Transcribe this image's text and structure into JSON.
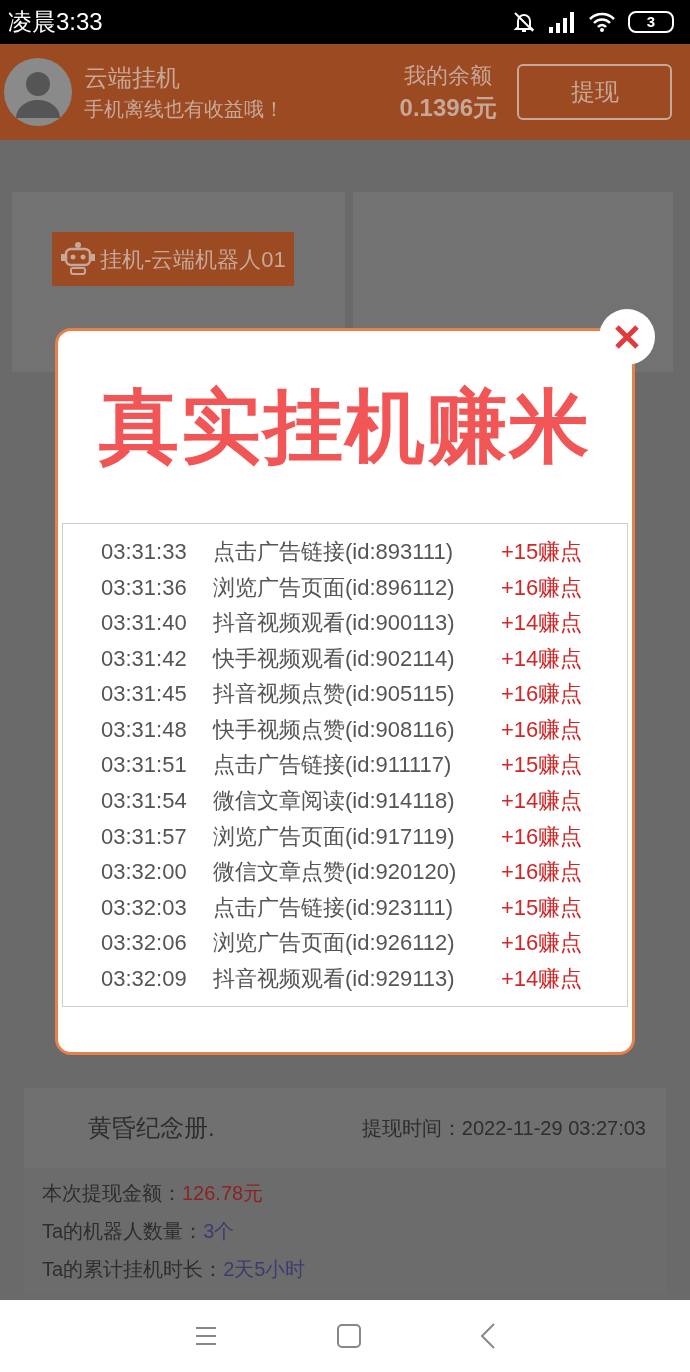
{
  "status_bar": {
    "time": "凌晨3:33",
    "battery": "3"
  },
  "header": {
    "title": "云端挂机",
    "subtitle": "手机离线也有收益哦！",
    "balance_label": "我的余额",
    "balance": "0.1396元",
    "withdraw_button": "提现"
  },
  "robot_card": {
    "button": "挂机-云端机器人01"
  },
  "record": {
    "name": "黄昏纪念册.",
    "time": "提现时间：2022-11-29 03:27:03",
    "details": [
      {
        "label": "本次提现金额：",
        "value": "126.78元",
        "kind": "amount"
      },
      {
        "label": "Ta的机器人数量：",
        "value": "3个",
        "kind": "count"
      },
      {
        "label": "Ta的累计挂机时长：",
        "value": "2天5小时",
        "kind": "count"
      }
    ]
  },
  "modal": {
    "title": "真实挂机赚米",
    "log": [
      {
        "time": "03:31:33",
        "task": "点击广告链接(id:893111)",
        "points": "+15赚点"
      },
      {
        "time": "03:31:36",
        "task": "浏览广告页面(id:896112)",
        "points": "+16赚点"
      },
      {
        "time": "03:31:40",
        "task": "抖音视频观看(id:900113)",
        "points": "+14赚点"
      },
      {
        "time": "03:31:42",
        "task": "快手视频观看(id:902114)",
        "points": "+14赚点"
      },
      {
        "time": "03:31:45",
        "task": "抖音视频点赞(id:905115)",
        "points": "+16赚点"
      },
      {
        "time": "03:31:48",
        "task": "快手视频点赞(id:908116)",
        "points": "+16赚点"
      },
      {
        "time": "03:31:51",
        "task": "点击广告链接(id:911117)",
        "points": "+15赚点"
      },
      {
        "time": "03:31:54",
        "task": "微信文章阅读(id:914118)",
        "points": "+14赚点"
      },
      {
        "time": "03:31:57",
        "task": "浏览广告页面(id:917119)",
        "points": "+16赚点"
      },
      {
        "time": "03:32:00",
        "task": "微信文章点赞(id:920120)",
        "points": "+16赚点"
      },
      {
        "time": "03:32:03",
        "task": "点击广告链接(id:923111)",
        "points": "+15赚点"
      },
      {
        "time": "03:32:06",
        "task": "浏览广告页面(id:926112)",
        "points": "+16赚点"
      },
      {
        "time": "03:32:09",
        "task": "抖音视频观看(id:929113)",
        "points": "+14赚点"
      }
    ]
  }
}
